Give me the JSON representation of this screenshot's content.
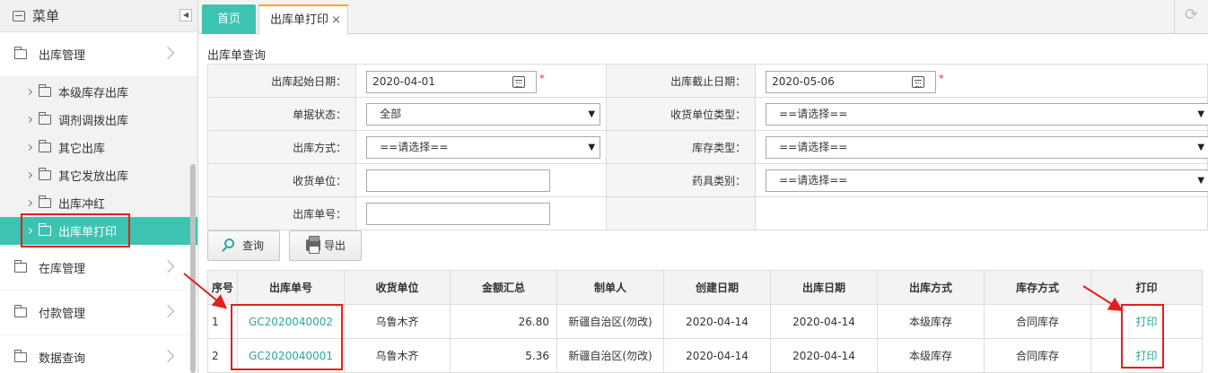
{
  "sidebar": {
    "title": "菜单",
    "groups": [
      {
        "label": "出库管理"
      },
      {
        "label": "在库管理"
      },
      {
        "label": "付款管理"
      },
      {
        "label": "数据查询"
      }
    ],
    "subitems": [
      {
        "label": "本级库存出库"
      },
      {
        "label": "调剂调拨出库"
      },
      {
        "label": "其它出库"
      },
      {
        "label": "其它发放出库"
      },
      {
        "label": "出库冲红"
      },
      {
        "label": "出库单打印"
      }
    ]
  },
  "tabs": {
    "home": "首页",
    "current": "出库单打印",
    "close": "×"
  },
  "query": {
    "section_title": "出库单查询",
    "start_date_label": "出库起始日期：",
    "start_date": "2020-04-01",
    "end_date_label": "出库截止日期：",
    "end_date": "2020-05-06",
    "required_mark": "*",
    "status_label": "单据状态：",
    "status_value": "全部",
    "receiver_type_label": "收货单位类型：",
    "receiver_type_value": "==请选择==",
    "outbound_method_label": "出库方式：",
    "outbound_method_value": "==请选择==",
    "stock_type_label": "库存类型：",
    "stock_type_value": "==请选择==",
    "receiver_label": "收货单位：",
    "receiver_value": "",
    "drug_category_label": "药具类别：",
    "drug_category_value": "==请选择==",
    "order_no_label": "出库单号：",
    "order_no_value": ""
  },
  "buttons": {
    "query": "查询",
    "export": "导出"
  },
  "grid": {
    "headers": [
      "序号",
      "出库单号",
      "收货单位",
      "金额汇总",
      "制单人",
      "创建日期",
      "出库日期",
      "出库方式",
      "库存方式",
      "打印"
    ],
    "rows": [
      {
        "seq": "1",
        "order_no": "GC2020040002",
        "receiver": "乌鲁木齐",
        "amount": "26.80",
        "creator": "新疆自治区(勿改)",
        "created": "2020-04-14",
        "out_date": "2020-04-14",
        "method": "本级库存",
        "stock": "合同库存",
        "print": "打印"
      },
      {
        "seq": "2",
        "order_no": "GC2020040001",
        "receiver": "乌鲁木齐",
        "amount": "5.36",
        "creator": "新疆自治区(勿改)",
        "created": "2020-04-14",
        "out_date": "2020-04-14",
        "method": "本级库存",
        "stock": "合同库存",
        "print": "打印"
      }
    ]
  },
  "colors": {
    "accent": "#3ec3b2",
    "link": "#27a99a",
    "highlight": "#e02020",
    "tab_top": "#f5a623"
  }
}
